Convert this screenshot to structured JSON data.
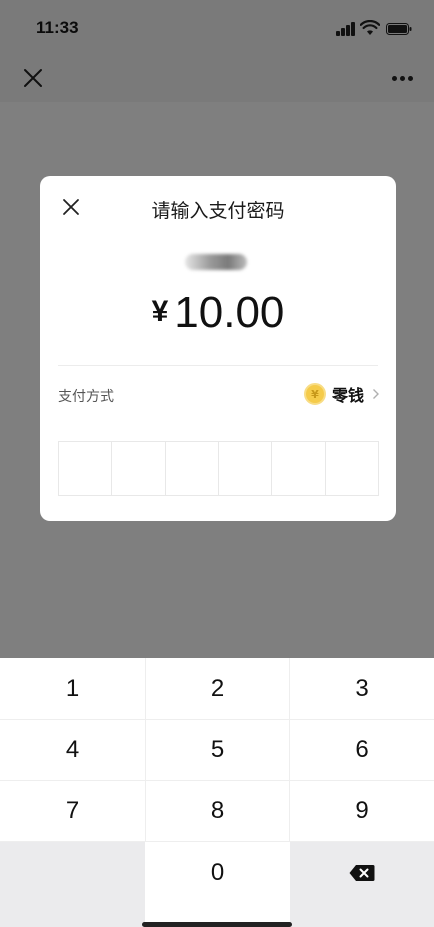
{
  "status_bar": {
    "time": "11:33"
  },
  "dialog": {
    "title": "请输入支付密码",
    "payee": "商户",
    "currency_symbol": "¥",
    "amount": "10.00",
    "payment_method_label": "支付方式",
    "payment_method_value": "零钱",
    "coin_symbol": "¥",
    "pin_length": 6
  },
  "keypad": {
    "keys": [
      "1",
      "2",
      "3",
      "4",
      "5",
      "6",
      "7",
      "8",
      "9"
    ],
    "zero": "0"
  },
  "icons": {
    "nav_close": "close-icon",
    "nav_more": "more-icon",
    "dialog_close": "close-icon",
    "backspace": "backspace-icon",
    "chevron": "chevron-right-icon"
  }
}
